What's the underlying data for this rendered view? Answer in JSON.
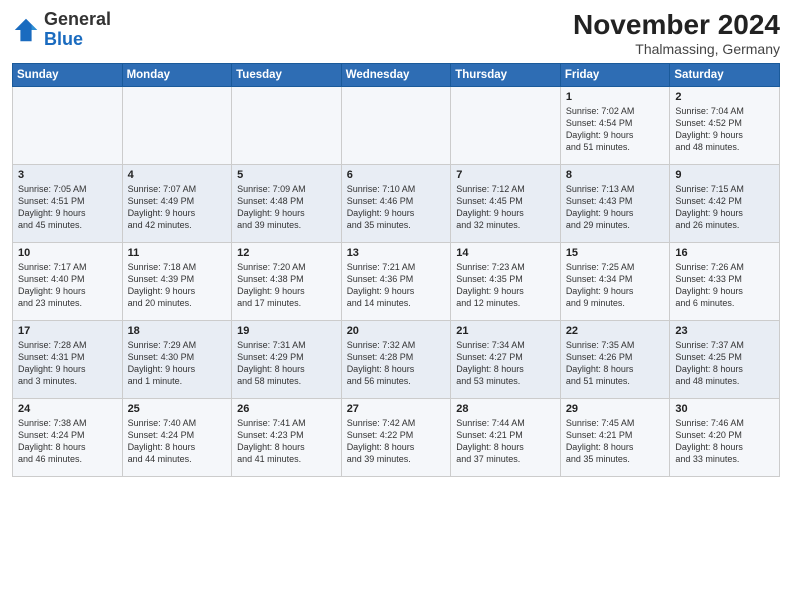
{
  "header": {
    "logo_general": "General",
    "logo_blue": "Blue",
    "month_title": "November 2024",
    "location": "Thalmassing, Germany"
  },
  "weekdays": [
    "Sunday",
    "Monday",
    "Tuesday",
    "Wednesday",
    "Thursday",
    "Friday",
    "Saturday"
  ],
  "weeks": [
    [
      {
        "day": "",
        "info": ""
      },
      {
        "day": "",
        "info": ""
      },
      {
        "day": "",
        "info": ""
      },
      {
        "day": "",
        "info": ""
      },
      {
        "day": "",
        "info": ""
      },
      {
        "day": "1",
        "info": "Sunrise: 7:02 AM\nSunset: 4:54 PM\nDaylight: 9 hours\nand 51 minutes."
      },
      {
        "day": "2",
        "info": "Sunrise: 7:04 AM\nSunset: 4:52 PM\nDaylight: 9 hours\nand 48 minutes."
      }
    ],
    [
      {
        "day": "3",
        "info": "Sunrise: 7:05 AM\nSunset: 4:51 PM\nDaylight: 9 hours\nand 45 minutes."
      },
      {
        "day": "4",
        "info": "Sunrise: 7:07 AM\nSunset: 4:49 PM\nDaylight: 9 hours\nand 42 minutes."
      },
      {
        "day": "5",
        "info": "Sunrise: 7:09 AM\nSunset: 4:48 PM\nDaylight: 9 hours\nand 39 minutes."
      },
      {
        "day": "6",
        "info": "Sunrise: 7:10 AM\nSunset: 4:46 PM\nDaylight: 9 hours\nand 35 minutes."
      },
      {
        "day": "7",
        "info": "Sunrise: 7:12 AM\nSunset: 4:45 PM\nDaylight: 9 hours\nand 32 minutes."
      },
      {
        "day": "8",
        "info": "Sunrise: 7:13 AM\nSunset: 4:43 PM\nDaylight: 9 hours\nand 29 minutes."
      },
      {
        "day": "9",
        "info": "Sunrise: 7:15 AM\nSunset: 4:42 PM\nDaylight: 9 hours\nand 26 minutes."
      }
    ],
    [
      {
        "day": "10",
        "info": "Sunrise: 7:17 AM\nSunset: 4:40 PM\nDaylight: 9 hours\nand 23 minutes."
      },
      {
        "day": "11",
        "info": "Sunrise: 7:18 AM\nSunset: 4:39 PM\nDaylight: 9 hours\nand 20 minutes."
      },
      {
        "day": "12",
        "info": "Sunrise: 7:20 AM\nSunset: 4:38 PM\nDaylight: 9 hours\nand 17 minutes."
      },
      {
        "day": "13",
        "info": "Sunrise: 7:21 AM\nSunset: 4:36 PM\nDaylight: 9 hours\nand 14 minutes."
      },
      {
        "day": "14",
        "info": "Sunrise: 7:23 AM\nSunset: 4:35 PM\nDaylight: 9 hours\nand 12 minutes."
      },
      {
        "day": "15",
        "info": "Sunrise: 7:25 AM\nSunset: 4:34 PM\nDaylight: 9 hours\nand 9 minutes."
      },
      {
        "day": "16",
        "info": "Sunrise: 7:26 AM\nSunset: 4:33 PM\nDaylight: 9 hours\nand 6 minutes."
      }
    ],
    [
      {
        "day": "17",
        "info": "Sunrise: 7:28 AM\nSunset: 4:31 PM\nDaylight: 9 hours\nand 3 minutes."
      },
      {
        "day": "18",
        "info": "Sunrise: 7:29 AM\nSunset: 4:30 PM\nDaylight: 9 hours\nand 1 minute."
      },
      {
        "day": "19",
        "info": "Sunrise: 7:31 AM\nSunset: 4:29 PM\nDaylight: 8 hours\nand 58 minutes."
      },
      {
        "day": "20",
        "info": "Sunrise: 7:32 AM\nSunset: 4:28 PM\nDaylight: 8 hours\nand 56 minutes."
      },
      {
        "day": "21",
        "info": "Sunrise: 7:34 AM\nSunset: 4:27 PM\nDaylight: 8 hours\nand 53 minutes."
      },
      {
        "day": "22",
        "info": "Sunrise: 7:35 AM\nSunset: 4:26 PM\nDaylight: 8 hours\nand 51 minutes."
      },
      {
        "day": "23",
        "info": "Sunrise: 7:37 AM\nSunset: 4:25 PM\nDaylight: 8 hours\nand 48 minutes."
      }
    ],
    [
      {
        "day": "24",
        "info": "Sunrise: 7:38 AM\nSunset: 4:24 PM\nDaylight: 8 hours\nand 46 minutes."
      },
      {
        "day": "25",
        "info": "Sunrise: 7:40 AM\nSunset: 4:24 PM\nDaylight: 8 hours\nand 44 minutes."
      },
      {
        "day": "26",
        "info": "Sunrise: 7:41 AM\nSunset: 4:23 PM\nDaylight: 8 hours\nand 41 minutes."
      },
      {
        "day": "27",
        "info": "Sunrise: 7:42 AM\nSunset: 4:22 PM\nDaylight: 8 hours\nand 39 minutes."
      },
      {
        "day": "28",
        "info": "Sunrise: 7:44 AM\nSunset: 4:21 PM\nDaylight: 8 hours\nand 37 minutes."
      },
      {
        "day": "29",
        "info": "Sunrise: 7:45 AM\nSunset: 4:21 PM\nDaylight: 8 hours\nand 35 minutes."
      },
      {
        "day": "30",
        "info": "Sunrise: 7:46 AM\nSunset: 4:20 PM\nDaylight: 8 hours\nand 33 minutes."
      }
    ]
  ]
}
